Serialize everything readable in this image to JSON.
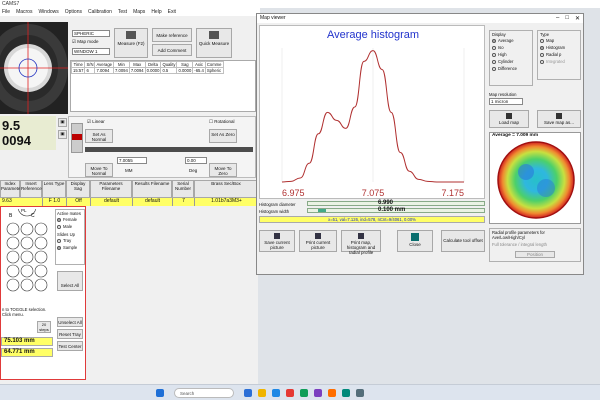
{
  "app": {
    "title": "CAMS7",
    "menu": [
      "File",
      "Macros",
      "Windows",
      "Options",
      "Calibration",
      "Test",
      "Maps",
      "Help",
      "Exit"
    ]
  },
  "lens_panel": {
    "readout1": "9.5",
    "readout2": "0094",
    "spheric": "SPHERIC",
    "map_mode": "Map mode",
    "window": "WINDOW 1",
    "measure": "Measure (F2)",
    "make_reference": "Make reference",
    "add_comment": "Add Comment",
    "quick_measure": "Quick Measure"
  },
  "results_table": {
    "headers": [
      "Time",
      "S/N",
      "Average",
      "Min",
      "Max",
      "Delta",
      "Quality",
      "Sag",
      "Axic",
      "Comme"
    ],
    "row": [
      "15:57",
      "6",
      "7.0094",
      "7.0094",
      "7.0094",
      "0.0000",
      "0.5",
      "0.0000",
      "-65.4",
      "Spheric"
    ]
  },
  "controls": {
    "linear": "Linear",
    "rotational": "Rotational",
    "set_as_normal": "Set As Normal",
    "set_as_zero": "Set As Zero",
    "move_to_normal": "Move To Normal",
    "move_to_zero": "Move To Zero",
    "val1": "7.0055",
    "mm": "MM",
    "val2": "0.00",
    "deg": "Deg"
  },
  "params_row": {
    "labels": [
      "Index Parameter",
      "Insert Reference",
      "Lens Type",
      "Display Sag",
      "Parameters Filename",
      "Results Filename",
      "Serial Number",
      "Brass Sec/Box"
    ],
    "values": [
      "9.63",
      "F 1.0",
      "Off",
      "default",
      "default",
      "7",
      "1.01b7a3M3+"
    ]
  },
  "tray": {
    "active_mates": "Active mates",
    "female": "Female",
    "male": "Male",
    "slides_up": "Slides Up",
    "tray": "Tray",
    "sample": "Sample",
    "select_all": "Select All",
    "unselect_all": "Unselect All",
    "reset_tray": "Reset Tray",
    "test_center": "Test Center",
    "cells_letters": [
      "B",
      "C"
    ],
    "pl": "PL",
    "note": "n to TOGGLE selection. Click menu.",
    "steps_value": "20",
    "steps_label": "steps",
    "value1": "75.103 mm",
    "value2": "64.771 mm"
  },
  "map_viewer": {
    "title": "Map viewer",
    "chart_title": "Average histogram",
    "x_ticks": [
      "6.975",
      "7.075",
      "7.175"
    ],
    "histogram_diameter_label": "Histogram diameter",
    "histogram_diameter": "6.990",
    "histogram_width_label": "Histogram width",
    "histogram_width": "0.100 mm",
    "stats": "x=51, val=7.126, ind=578, nCnt=9/4061, 0.00%",
    "display_label": "Display",
    "display_options": [
      "Average",
      "Iso",
      "High",
      "Cylinder",
      "Difference"
    ],
    "type_label": "Type",
    "type_options": [
      "Map",
      "Histogram",
      "Radial p",
      "Integrated"
    ],
    "resolution_label": "Map resolution",
    "resolution": "1 micron",
    "load_map": "Load map",
    "save_map": "Save map as...",
    "map_caption": "Average = 7.009 mm",
    "buttons": [
      "Save current picture",
      "Print current picture",
      "Print map, histogram and radial profile",
      "Close",
      "Calculate tool offset"
    ],
    "radial_label": "Radial profile parameters for Ave/Low/High/Cyl",
    "radial_mode": "Full tolerance / integral length",
    "position_btn": "Position"
  },
  "chart_data": {
    "type": "line",
    "title": "Average histogram",
    "x": [
      6.975,
      6.985,
      6.995,
      7.005,
      7.015,
      7.025,
      7.035,
      7.045,
      7.055,
      7.065,
      7.075,
      7.085,
      7.095,
      7.105,
      7.115,
      7.125,
      7.135,
      7.145,
      7.155,
      7.175
    ],
    "y": [
      0,
      0.5,
      3,
      14,
      36,
      52,
      46,
      40,
      56,
      90,
      98,
      84,
      52,
      22,
      8,
      2,
      0.5,
      0,
      0,
      0
    ],
    "xlim": [
      6.975,
      7.175
    ],
    "ylim": [
      0,
      100
    ],
    "xlabel": "",
    "ylabel": "",
    "color": "#b03030",
    "title_color": "#2233cc"
  },
  "taskbar": {
    "search_placeholder": "Search",
    "icon_colors": [
      "#2c6fd6",
      "#f0b400",
      "#1e88e5",
      "#e53935",
      "#0f9d58",
      "#7b3fbf",
      "#ff6d00",
      "#00897b",
      "#546e7a"
    ]
  }
}
